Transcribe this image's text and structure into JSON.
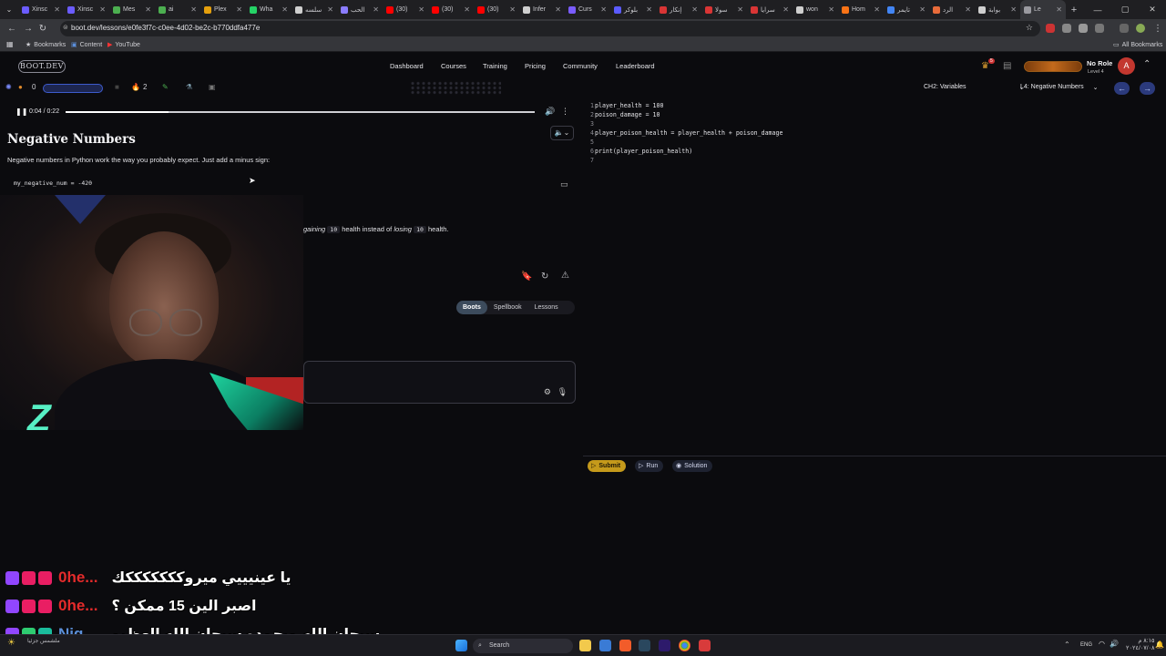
{
  "browser": {
    "tabs": [
      {
        "label": "Xinsc",
        "color": "#6b5cff"
      },
      {
        "label": "Xinsc",
        "color": "#6b5cff"
      },
      {
        "label": "Mes",
        "color": "#4caf50"
      },
      {
        "label": "ai",
        "color": "#4caf50"
      },
      {
        "label": "Plex",
        "color": "#e5a00d"
      },
      {
        "label": "Wha",
        "color": "#25d366"
      },
      {
        "label": "سلسه",
        "color": "#cfcfcf"
      },
      {
        "label": "الحب",
        "color": "#8a7cff"
      },
      {
        "label": "(30)",
        "color": "#ff0000"
      },
      {
        "label": "(30)",
        "color": "#ff0000"
      },
      {
        "label": "(30)",
        "color": "#ff0000"
      },
      {
        "label": "Infer",
        "color": "#cfcfcf"
      },
      {
        "label": "Curs",
        "color": "#7a5cff"
      },
      {
        "label": "بلوكر",
        "color": "#5b5bff"
      },
      {
        "label": "إنكار",
        "color": "#d93535"
      },
      {
        "label": "سولا",
        "color": "#d93535"
      },
      {
        "label": "سرايا",
        "color": "#d93535"
      },
      {
        "label": "won",
        "color": "#cfcfcf"
      },
      {
        "label": "Hom",
        "color": "#f97316"
      },
      {
        "label": "تايمر",
        "color": "#4285f4"
      },
      {
        "label": "الرد",
        "color": "#e86b3a"
      },
      {
        "label": "بوابة",
        "color": "#cfcfcf"
      },
      {
        "label": "Le",
        "color": "#9a9aa0"
      }
    ],
    "url": "boot.dev/lessons/e0fe3f7c-c0ee-4d02-be2c-b770ddfa477e",
    "bookmarks": [
      {
        "label": "Bookmarks",
        "icon": "star-icon"
      },
      {
        "label": "Content",
        "icon": "folder-icon"
      },
      {
        "label": "YouTube",
        "icon": "youtube-icon"
      }
    ],
    "all_bookmarks_label": "All Bookmarks"
  },
  "site": {
    "logo": "BOOT.DEV",
    "nav": [
      "Dashboard",
      "Courses",
      "Training",
      "Pricing",
      "Community",
      "Leaderboard"
    ],
    "notif_count": "5",
    "user_role": "No Role",
    "user_level": "Level 4",
    "avatar_letter": "A"
  },
  "toolbar": {
    "gems": "0",
    "streak": "2",
    "chapter_select": "CH2: Variables",
    "lesson_select": "L4: Negative Numbers"
  },
  "lesson": {
    "audio_time": "0:04 / 0:22",
    "audio_progress": 0.22,
    "title": "Negative Numbers",
    "description": "Negative numbers in Python work the way you probably expect. Just add a minus sign:",
    "code_example": "my_negative_num = -420",
    "partial_text_1": "gaining",
    "partial_code_1": "10",
    "partial_text_2": "health instead of",
    "partial_text_3": "losing",
    "partial_code_2": "10",
    "partial_text_4": "health.",
    "tabs": [
      "Boots",
      "Spellbook",
      "Lessons"
    ],
    "active_tab": "Boots"
  },
  "editor": {
    "lines": [
      {
        "n": "1",
        "code": "player_health = 100"
      },
      {
        "n": "2",
        "code": "poison_damage = 10"
      },
      {
        "n": "3",
        "code": ""
      },
      {
        "n": "4",
        "code": "player_poison_health = player_health + poison_damage"
      },
      {
        "n": "5",
        "code": ""
      },
      {
        "n": "6",
        "code": "print(player_poison_health)"
      },
      {
        "n": "7",
        "code": ""
      }
    ],
    "submit_label": "Submit",
    "run_label": "Run",
    "solution_label": "Solution"
  },
  "chat": [
    {
      "name": "0he...",
      "name_color": "#e52b2b",
      "message": "يا عينيييي ميروكككككككك"
    },
    {
      "name": "0he...",
      "name_color": "#e52b2b",
      "message": "اصبر الين 15 ممكن ؟"
    },
    {
      "name": "Nig...",
      "name_color": "#5b8fd8",
      "message": "سبحان الله وبحمده سبحان الله العظيم"
    }
  ],
  "taskbar": {
    "search_placeholder": "Search",
    "weather": "ملشمس جزئيا",
    "lang": "ENG",
    "time": "٨:١٥ م",
    "date": "٢٠٢٤/٠٧/٠٨"
  },
  "colors": {
    "accent_gold": "#c59a1b",
    "avatar_red": "#c3372f",
    "editor_bg": "#0b0b0e"
  }
}
